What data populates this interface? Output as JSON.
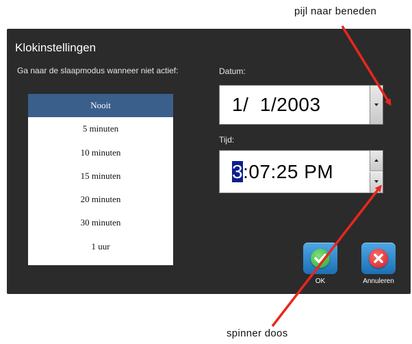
{
  "annotations": {
    "top": "pijl naar beneden",
    "bottom": "spinner doos"
  },
  "dialog": {
    "title": "Klokinstellingen",
    "sleep_label": "Ga naar de slaapmodus wanneer niet actief:",
    "sleep_options": [
      "Nooit",
      "5 minuten",
      "10 minuten",
      "15 minuten",
      "20 minuten",
      "30 minuten",
      "1 uur"
    ],
    "selected_option": "Nooit",
    "date_label": "Datum:",
    "date_value": "1/  1/2003",
    "time_label": "Tijd:",
    "time_highlight": "3",
    "time_rest": ":07:25 PM",
    "ok_label": "OK",
    "cancel_label": "Annuleren",
    "icons": {
      "dropdown": "chevron-down-icon",
      "spinner_up": "chevron-up-icon",
      "spinner_down": "chevron-down-icon",
      "ok": "checkmark-icon",
      "cancel": "x-icon"
    }
  },
  "colors": {
    "dialog_bg": "#2b2b2b",
    "selected_item": "#3a5f8b",
    "button_blue": "#2a85cc",
    "annotation_arrow": "#e8271d"
  }
}
